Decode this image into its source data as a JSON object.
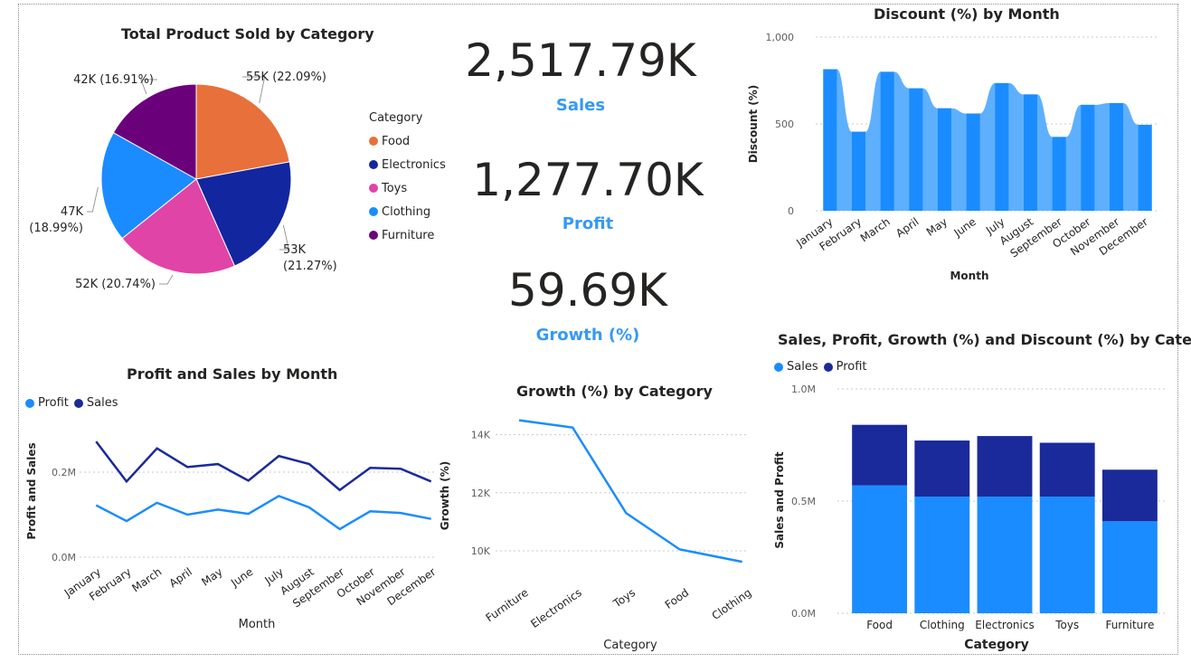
{
  "colors": {
    "food": "#e8703a",
    "electronics": "#1226a0",
    "toys": "#e044a7",
    "clothing": "#1a8cff",
    "furniture": "#6b007b",
    "sales": "#1a8cff",
    "profit": "#1a2a9a",
    "accent": "#3599f5",
    "discount_bar": "#1a8cff",
    "discount_area": "#5eb0ff",
    "line": "#1a8cff"
  },
  "kpis": [
    {
      "value": "2,517.79K",
      "label": "Sales"
    },
    {
      "value": "1,277.70K",
      "label": "Profit"
    },
    {
      "value": "59.69K",
      "label": "Growth (%)"
    }
  ],
  "chart_data": [
    {
      "id": "pie",
      "type": "pie",
      "title": "Total Product Sold by Category",
      "legend_title": "Category",
      "legend_position": "right",
      "slices": [
        {
          "name": "Food",
          "value": 55,
          "label": "55K (22.09%)"
        },
        {
          "name": "Electronics",
          "value": 53,
          "label": "53K (21.27%)"
        },
        {
          "name": "Toys",
          "value": 52,
          "label": "52K (20.74%)"
        },
        {
          "name": "Clothing",
          "value": 47,
          "label": "47K (18.99%)"
        },
        {
          "name": "Furniture",
          "value": 42,
          "label": "42K (16.91%)"
        }
      ]
    },
    {
      "id": "discount",
      "type": "bar",
      "title": "Discount (%) by Month",
      "xlabel": "Month",
      "ylabel": "Discount (%)",
      "ylim": [
        0,
        1000
      ],
      "yticks": [
        "0",
        "500",
        "1,000"
      ],
      "grid": true,
      "categories": [
        "January",
        "February",
        "March",
        "April",
        "May",
        "June",
        "July",
        "August",
        "September",
        "October",
        "November",
        "December"
      ],
      "values": [
        815,
        455,
        800,
        705,
        590,
        560,
        735,
        670,
        425,
        610,
        620,
        495
      ]
    },
    {
      "id": "profit_sales",
      "type": "line",
      "title": "Profit and Sales by Month",
      "xlabel": "Month",
      "ylabel": "Profit and Sales",
      "ylim": [
        0,
        0.3
      ],
      "yticks": [
        "0.0M",
        "0.2M"
      ],
      "grid": true,
      "legend_position": "top-left",
      "categories": [
        "January",
        "February",
        "March",
        "April",
        "May",
        "June",
        "July",
        "August",
        "September",
        "October",
        "November",
        "December"
      ],
      "series": [
        {
          "name": "Profit",
          "values": [
            0.122,
            0.085,
            0.128,
            0.1,
            0.112,
            0.102,
            0.144,
            0.117,
            0.066,
            0.108,
            0.104,
            0.09
          ]
        },
        {
          "name": "Sales",
          "values": [
            0.272,
            0.178,
            0.256,
            0.212,
            0.219,
            0.18,
            0.238,
            0.219,
            0.158,
            0.21,
            0.208,
            0.178
          ]
        }
      ]
    },
    {
      "id": "growth",
      "type": "line",
      "title": "Growth (%) by Category",
      "xlabel": "Category",
      "ylabel": "Growth (%)",
      "ylim": [
        9500,
        14800
      ],
      "yticks": [
        "10K",
        "12K",
        "14K"
      ],
      "grid": true,
      "categories": [
        "Furniture",
        "Electronics",
        "Toys",
        "Food",
        "Clothing"
      ],
      "values": [
        14500,
        14250,
        11300,
        10050,
        9620
      ]
    },
    {
      "id": "stacked",
      "type": "bar",
      "title": "Sales, Profit, Growth (%) and Discount (%) by Category",
      "xlabel": "Category",
      "ylabel": "Sales and Profit",
      "ylim": [
        0,
        1.0
      ],
      "yticks": [
        "0.0M",
        "0.5M",
        "1.0M"
      ],
      "grid": true,
      "legend_position": "top-left",
      "categories": [
        "Food",
        "Clothing",
        "Electronics",
        "Toys",
        "Furniture"
      ],
      "series": [
        {
          "name": "Sales",
          "values": [
            0.57,
            0.52,
            0.52,
            0.52,
            0.41
          ]
        },
        {
          "name": "Profit",
          "values": [
            0.27,
            0.25,
            0.27,
            0.24,
            0.23
          ]
        }
      ]
    }
  ]
}
